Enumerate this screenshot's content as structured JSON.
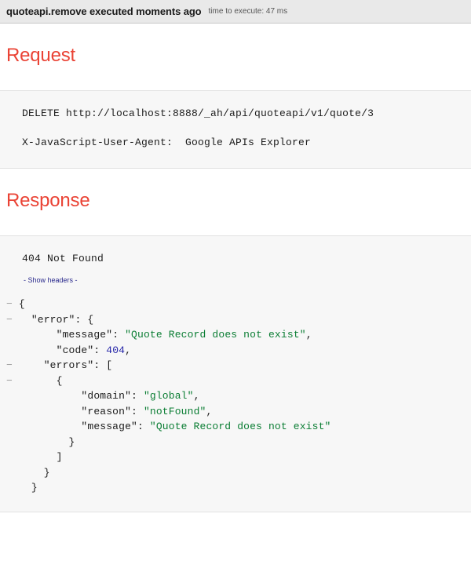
{
  "header": {
    "title": "quoteapi.remove executed moments ago",
    "time_label": "time to execute: 47 ms"
  },
  "request": {
    "heading": "Request",
    "lines": [
      "DELETE http://localhost:8888/_ah/api/quoteapi/v1/quote/3",
      "X-JavaScript-User-Agent:  Google APIs Explorer"
    ]
  },
  "response": {
    "heading": "Response",
    "status": "404 Not Found",
    "show_headers_label": "- Show headers -",
    "json_lines": [
      {
        "toggle": "−",
        "indent": 0,
        "segments": [
          {
            "t": "punct",
            "v": "{"
          }
        ]
      },
      {
        "toggle": "−",
        "indent": 1,
        "segments": [
          {
            "t": "key",
            "v": "\"error\""
          },
          {
            "t": "punct",
            "v": ": {"
          }
        ]
      },
      {
        "toggle": "",
        "indent": 3,
        "segments": [
          {
            "t": "key",
            "v": "\"message\""
          },
          {
            "t": "punct",
            "v": ": "
          },
          {
            "t": "str",
            "v": "\"Quote Record does not exist\""
          },
          {
            "t": "punct",
            "v": ","
          }
        ]
      },
      {
        "toggle": "",
        "indent": 3,
        "segments": [
          {
            "t": "key",
            "v": "\"code\""
          },
          {
            "t": "punct",
            "v": ": "
          },
          {
            "t": "num",
            "v": "404"
          },
          {
            "t": "punct",
            "v": ","
          }
        ]
      },
      {
        "toggle": "−",
        "indent": 2,
        "segments": [
          {
            "t": "key",
            "v": "\"errors\""
          },
          {
            "t": "punct",
            "v": ": ["
          }
        ]
      },
      {
        "toggle": "−",
        "indent": 3,
        "segments": [
          {
            "t": "punct",
            "v": "{"
          }
        ]
      },
      {
        "toggle": "",
        "indent": 5,
        "segments": [
          {
            "t": "key",
            "v": "\"domain\""
          },
          {
            "t": "punct",
            "v": ": "
          },
          {
            "t": "str",
            "v": "\"global\""
          },
          {
            "t": "punct",
            "v": ","
          }
        ]
      },
      {
        "toggle": "",
        "indent": 5,
        "segments": [
          {
            "t": "key",
            "v": "\"reason\""
          },
          {
            "t": "punct",
            "v": ": "
          },
          {
            "t": "str",
            "v": "\"notFound\""
          },
          {
            "t": "punct",
            "v": ","
          }
        ]
      },
      {
        "toggle": "",
        "indent": 5,
        "segments": [
          {
            "t": "key",
            "v": "\"message\""
          },
          {
            "t": "punct",
            "v": ": "
          },
          {
            "t": "str",
            "v": "\"Quote Record does not exist\""
          }
        ]
      },
      {
        "toggle": "",
        "indent": 4,
        "segments": [
          {
            "t": "punct",
            "v": "}"
          }
        ]
      },
      {
        "toggle": "",
        "indent": 3,
        "segments": [
          {
            "t": "punct",
            "v": "]"
          }
        ]
      },
      {
        "toggle": "",
        "indent": 2,
        "segments": [
          {
            "t": "punct",
            "v": "}"
          }
        ]
      },
      {
        "toggle": "",
        "indent": 1,
        "segments": [
          {
            "t": "punct",
            "v": "}"
          }
        ]
      }
    ]
  },
  "colors": {
    "heading": "#ea4335",
    "string": "#0a7d33",
    "number": "#2424a8",
    "link": "#2a2a8c",
    "panel_bg": "#f7f7f7",
    "header_bg": "#e9e9e9"
  }
}
